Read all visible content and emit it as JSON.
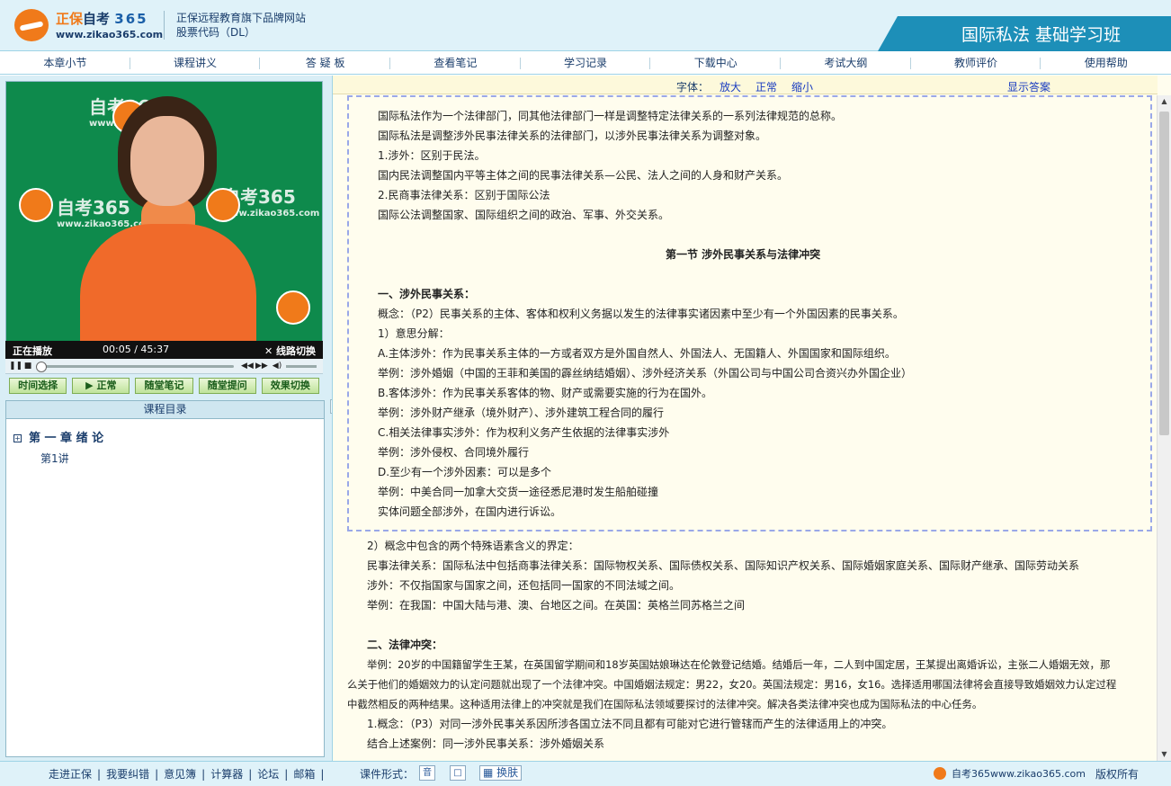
{
  "header": {
    "brand_cn": "正保",
    "brand_name": "自考",
    "brand_num": "365",
    "url": "www.zikao365.com",
    "site_line1": "正保远程教育旗下品牌网站",
    "site_line2": "股票代码（DL）",
    "course_title": "国际私法 基础学习班"
  },
  "nav": [
    "本章小节",
    "课程讲义",
    "答 疑 板",
    "查看笔记",
    "学习记录",
    "下载中心",
    "考试大纲",
    "教师评价",
    "使用帮助"
  ],
  "video": {
    "bg_logo": "自考365",
    "bg_url": "www.zikao365.com",
    "status": "正在播放",
    "time": "00:05 / 45:37",
    "switch_label": "线路切换",
    "progress_fraction": 0.002
  },
  "actions": [
    "时间选择",
    "▶ 正常",
    "随堂笔记",
    "随堂提问",
    "效果切换"
  ],
  "toc": {
    "title": "课程目录",
    "chapter": "第 一 章  绪  论",
    "lecture": "第1讲"
  },
  "toolbar": {
    "font_label": "字体：",
    "enlarge": "放大",
    "normal": "正常",
    "shrink": "缩小",
    "show_answer": "显示答案"
  },
  "content": {
    "p1": "国际私法作为一个法律部门，同其他法律部门一样是调整特定法律关系的一系列法律规范的总称。",
    "p2": "国际私法是调整涉外民事法律关系的法律部门，以涉外民事法律关系为调整对象。",
    "p3": "1.涉外：区别于民法。",
    "p4": "国内民法调整国内平等主体之间的民事法律关系—公民、法人之间的人身和财产关系。",
    "p5": "2.民商事法律关系：区别于国际公法",
    "p6": "国际公法调整国家、国际组织之间的政治、军事、外交关系。",
    "section_title": "第一节  涉外民事关系与法律冲突",
    "h1": "一、涉外民事关系：",
    "p7": "概念：（P2）民事关系的主体、客体和权利义务据以发生的法律事实诸因素中至少有一个外国因素的民事关系。",
    "p8": "1）意思分解：",
    "p9": "A.主体涉外：作为民事关系主体的一方或者双方是外国自然人、外国法人、无国籍人、外国国家和国际组织。",
    "p10": "举例：涉外婚姻（中国的王菲和美国的霹丝纳结婚姻）、涉外经济关系（外国公司与中国公司合资兴办外国企业）",
    "p11": "B.客体涉外：作为民事关系客体的物、财产或需要实施的行为在国外。",
    "p12": "举例：涉外财产继承（境外财产）、涉外建筑工程合同的履行",
    "p13": "C.相关法律事实涉外：作为权利义务产生依据的法律事实涉外",
    "p14": "举例：涉外侵权、合同境外履行",
    "p15": "D.至少有一个涉外因素：可以是多个",
    "p16": "举例：中美合同一加拿大交货一途径悉尼港时发生船舶碰撞",
    "p17": "实体问题全部涉外，在国内进行诉讼。",
    "p18": "2）概念中包含的两个特殊语素含义的界定：",
    "p19": "民事法律关系：国际私法中包括商事法律关系：国际物权关系、国际债权关系、国际知识产权关系、国际婚姻家庭关系、国际财产继承、国际劳动关系",
    "p20": "涉外：不仅指国家与国家之间，还包括同一国家的不同法域之间。",
    "p21": "举例：在我国：中国大陆与港、澳、台地区之间。在英国：英格兰同苏格兰之间",
    "h2": "二、法律冲突：",
    "p22a": "举例：20岁的中国籍留学生王某，在英国留学期间和18岁英国姑娘琳达在伦敦登记结婚。结婚后一年，二人到中国定居，王某提出离婚诉讼，主张二人婚姻无效，那",
    "p22b": "么关于他们的婚姻效力的认定问题就出现了一个法律冲突。中国婚姻法规定：男22，女20。英国法规定：男16，女16。选择适用哪国法律将会直接导致婚姻效力认定过程",
    "p22c": "中截然相反的两种结果。这种适用法律上的冲突就是我们在国际私法领域要探讨的法律冲突。解决各类法律冲突也成为国际私法的中心任务。",
    "p23": "1.概念：（P3）对同一涉外民事关系因所涉各国立法不同且都有可能对它进行管辖而产生的法律适用上的冲突。",
    "p24": "结合上述案例：同一涉外民事关系：涉外婚姻关系"
  },
  "footer": {
    "links": [
      "走进正保",
      "我要纠错",
      "意见簿",
      "计算器",
      "论坛",
      "邮箱"
    ],
    "form_label": "课件形式：",
    "fbtn1": "音",
    "fbtn2": "□",
    "skin": "换肤",
    "brand": "自考365www.zikao365.com",
    "copyright": "版权所有"
  }
}
